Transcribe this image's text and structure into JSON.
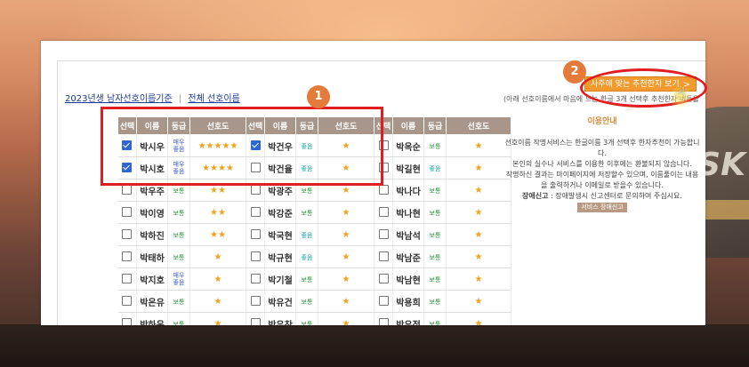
{
  "header": {
    "link_active": "2023년생 남자선호이름기준",
    "separator": "|",
    "link_all": "전체 선호이름",
    "note": "(아래 선호이름에서 마음에 드는 한글 3개 선택후 추천한자 버튼을 클릭하세요)",
    "recommend_button": "사주에 맞는 추천한자 보기",
    "recommend_chevron": ">"
  },
  "table": {
    "headers": [
      "선택",
      "이름",
      "등급",
      "선호도",
      "선택",
      "이름",
      "등급",
      "선호도",
      "선택",
      "이름",
      "등급",
      "선호도"
    ],
    "rows": [
      [
        {
          "checked": true,
          "name": "박시우",
          "grade": "매우좋음",
          "gclass": "vgood",
          "stars": 5
        },
        {
          "checked": true,
          "name": "박건우",
          "grade": "좋음",
          "gclass": "good",
          "stars": 1
        },
        {
          "checked": false,
          "name": "박옥순",
          "grade": "보통",
          "gclass": "normal",
          "stars": 1
        }
      ],
      [
        {
          "checked": true,
          "name": "박시호",
          "grade": "매우좋음",
          "gclass": "vgood",
          "stars": 4
        },
        {
          "checked": false,
          "name": "박건율",
          "grade": "좋음",
          "gclass": "good",
          "stars": 1
        },
        {
          "checked": false,
          "name": "박길현",
          "grade": "좋음",
          "gclass": "good",
          "stars": 1
        }
      ],
      [
        {
          "checked": false,
          "name": "박우주",
          "grade": "보통",
          "gclass": "normal",
          "stars": 2
        },
        {
          "checked": false,
          "name": "박광주",
          "grade": "보통",
          "gclass": "normal",
          "stars": 1
        },
        {
          "checked": false,
          "name": "박나다",
          "grade": "보통",
          "gclass": "normal",
          "stars": 1
        }
      ],
      [
        {
          "checked": false,
          "name": "박이영",
          "grade": "보통",
          "gclass": "normal",
          "stars": 2
        },
        {
          "checked": false,
          "name": "박강준",
          "grade": "보통",
          "gclass": "normal",
          "stars": 1
        },
        {
          "checked": false,
          "name": "박나현",
          "grade": "보통",
          "gclass": "normal",
          "stars": 1
        }
      ],
      [
        {
          "checked": false,
          "name": "박하진",
          "grade": "보통",
          "gclass": "normal",
          "stars": 2
        },
        {
          "checked": false,
          "name": "박국현",
          "grade": "좋음",
          "gclass": "good",
          "stars": 1
        },
        {
          "checked": false,
          "name": "박남석",
          "grade": "보통",
          "gclass": "normal",
          "stars": 1
        }
      ],
      [
        {
          "checked": false,
          "name": "박태하",
          "grade": "보통",
          "gclass": "normal",
          "stars": 1
        },
        {
          "checked": false,
          "name": "박규현",
          "grade": "좋음",
          "gclass": "good",
          "stars": 1
        },
        {
          "checked": false,
          "name": "박남준",
          "grade": "보통",
          "gclass": "normal",
          "stars": 1
        }
      ],
      [
        {
          "checked": false,
          "name": "박지호",
          "grade": "매우좋음",
          "gclass": "vgood",
          "stars": 1
        },
        {
          "checked": false,
          "name": "박기철",
          "grade": "보통",
          "gclass": "normal",
          "stars": 1
        },
        {
          "checked": false,
          "name": "박남현",
          "grade": "보통",
          "gclass": "normal",
          "stars": 1
        }
      ],
      [
        {
          "checked": false,
          "name": "박온유",
          "grade": "보통",
          "gclass": "normal",
          "stars": 1
        },
        {
          "checked": false,
          "name": "박유건",
          "grade": "보통",
          "gclass": "normal",
          "stars": 1
        },
        {
          "checked": false,
          "name": "박용희",
          "grade": "보통",
          "gclass": "normal",
          "stars": 1
        }
      ],
      [
        {
          "checked": false,
          "name": "박하온",
          "grade": "보통",
          "gclass": "normal",
          "stars": 1
        },
        {
          "checked": false,
          "name": "박유찬",
          "grade": "보통",
          "gclass": "normal",
          "stars": 1
        },
        {
          "checked": false,
          "name": "박우정",
          "grade": "보통",
          "gclass": "normal",
          "stars": 1
        }
      ]
    ]
  },
  "guide": {
    "title": "이용안내",
    "p1": "선호이름 작명서비스는 한글이름 3개 선택후 한자추천이 가능합니다.",
    "p2": "본인의 실수나 서비스를 이용한 이후에는 환불되지 않습니다.",
    "p3": "작명하신 결과는 마이페이지에 저장할수 있으며, 이름풀이는 내용을 출력하거나 이메일로 받을수 있습니다.",
    "p4_bold": "장애신고",
    "p4": ": 장애발생시 신고센터로 문의하여 주십시요.",
    "service_btn": "서비스 장애신고"
  },
  "annotations": {
    "badge1": "1",
    "badge2": "2"
  },
  "background": {
    "hat_text": "SK"
  },
  "colors": {
    "accent_orange": "#f29a2e",
    "highlight_red": "#e01e22",
    "header_brown": "#a8968a",
    "badge_orange": "#e57b3a"
  }
}
